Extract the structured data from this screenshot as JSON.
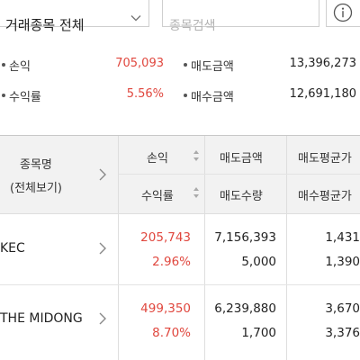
{
  "filter": {
    "trade_type_value": "거래종목 전체",
    "search_placeholder": "종목검색"
  },
  "summary": {
    "profit_label": "손익",
    "profit_value": "705,093",
    "rate_label": "수익률",
    "rate_value": "5.56%",
    "sell_amount_label": "매도금액",
    "sell_amount_value": "13,396,273",
    "buy_amount_label": "매수금액",
    "buy_amount_value": "12,691,180"
  },
  "table": {
    "headers": {
      "stock_name": "종목명",
      "view_all": "(전체보기)",
      "profit": "손익",
      "rate": "수익률",
      "sell_amount": "매도금액",
      "sell_qty": "매도수량",
      "sell_avg": "매도평균가",
      "buy_avg": "매수평균가"
    },
    "rows": [
      {
        "name": "KEC",
        "profit": "205,743",
        "rate": "2.96%",
        "sell_amount": "7,156,393",
        "sell_qty": "5,000",
        "sell_avg": "1,431",
        "buy_avg": "1,390"
      },
      {
        "name": "THE MIDONG",
        "profit": "499,350",
        "rate": "8.70%",
        "sell_amount": "6,239,880",
        "sell_qty": "1,700",
        "sell_avg": "3,670",
        "buy_avg": "3,376"
      }
    ]
  },
  "colors": {
    "positive": "#e0473e",
    "header_bg": "#f2f2f2"
  }
}
